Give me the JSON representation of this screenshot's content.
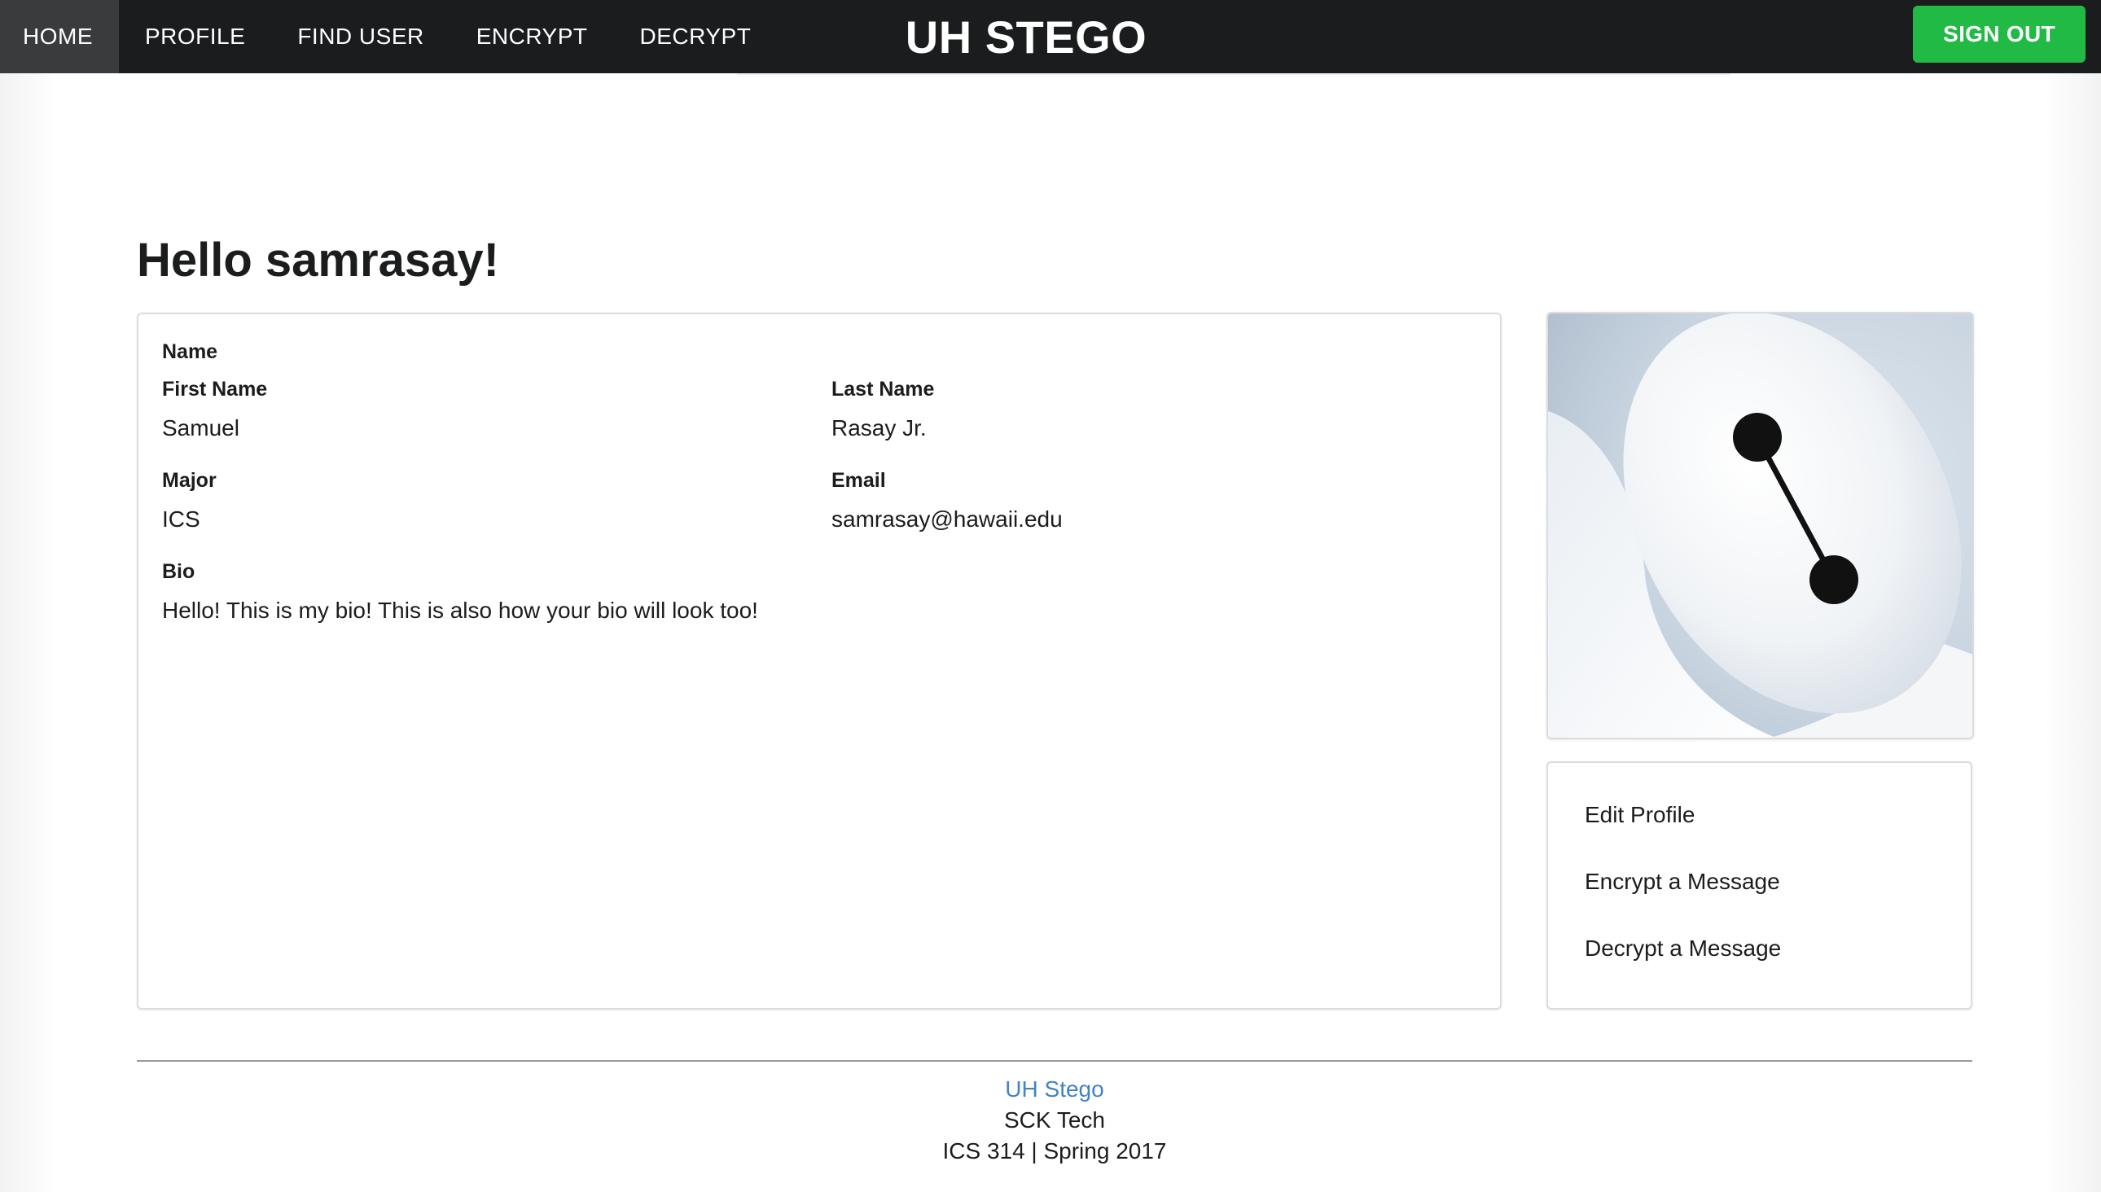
{
  "nav": {
    "items": [
      {
        "label": "HOME"
      },
      {
        "label": "PROFILE"
      },
      {
        "label": "FIND USER"
      },
      {
        "label": "ENCRYPT"
      },
      {
        "label": "DECRYPT"
      }
    ],
    "brand": "UH STEGO",
    "sign_out": "SIGN OUT"
  },
  "greeting": "Hello samrasay!",
  "profile": {
    "name_heading": "Name",
    "first_name_label": "First Name",
    "first_name": "Samuel",
    "last_name_label": "Last Name",
    "last_name": "Rasay Jr.",
    "major_label": "Major",
    "major": "ICS",
    "email_label": "Email",
    "email": "samrasay@hawaii.edu",
    "bio_label": "Bio",
    "bio": "Hello! This is my bio! This is also how your bio will look too!"
  },
  "menu": {
    "items": [
      {
        "label": "Edit Profile"
      },
      {
        "label": "Encrypt a Message"
      },
      {
        "label": "Decrypt a Message"
      }
    ]
  },
  "footer": {
    "link": "UH Stego",
    "company": "SCK Tech",
    "course": "ICS 314 | Spring 2017"
  },
  "colors": {
    "navbar": "#1b1c1d",
    "nav_active": "#3a3b3c",
    "sign_out": "#21ba45",
    "link": "#4183c4"
  }
}
